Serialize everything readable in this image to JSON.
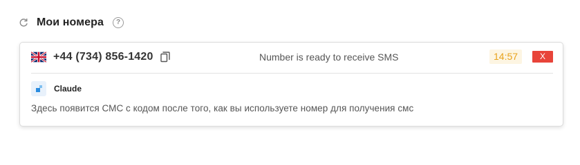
{
  "header": {
    "title": "Мои номера",
    "refresh_icon": "refresh-icon",
    "help_icon": "help-icon",
    "help_glyph": "?"
  },
  "number_card": {
    "country_flag": "uk-flag-icon",
    "phone_number": "+44 (734) 856-1420",
    "copy_icon": "copy-icon",
    "status_text": "Number is ready to receive SMS",
    "timer": "14:57",
    "close_label": "X",
    "service_icon": "claude-service-icon",
    "service_name": "Claude",
    "sms_placeholder": "Здесь появится СМС с кодом после того, как вы используете номер для получения смс"
  },
  "colors": {
    "timer_text": "#e8a21c",
    "timer_bg": "#fdf5e2",
    "close_bg": "#e8443a",
    "card_border": "#dcdcdc"
  }
}
